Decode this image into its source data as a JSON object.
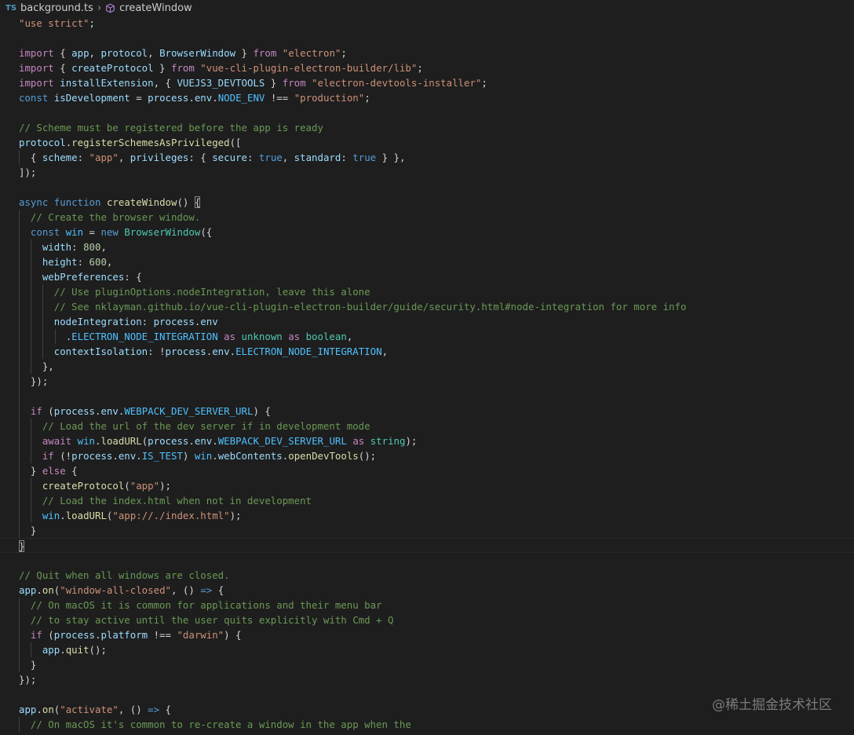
{
  "breadcrumb": {
    "lang_badge": "TS",
    "file": "background.ts",
    "symbol": "createWindow"
  },
  "colors": {
    "background": "#1e1e1e",
    "keyword": "#569cd6",
    "control": "#c586c0",
    "string": "#ce9178",
    "comment": "#6a9955",
    "function": "#dcdcaa",
    "variable": "#9cdcfe",
    "constant": "#4fc1ff",
    "number": "#b5cea8",
    "type": "#4ec9b0"
  },
  "editor": {
    "active_line": 35,
    "lines": [
      {
        "indent": 0,
        "tokens": [
          [
            "str",
            "\"use strict\""
          ],
          [
            "pun",
            ";"
          ]
        ]
      },
      {
        "indent": 0,
        "tokens": []
      },
      {
        "indent": 0,
        "tokens": [
          [
            "ctl",
            "import"
          ],
          [
            "pun",
            " { "
          ],
          [
            "var",
            "app"
          ],
          [
            "pun",
            ", "
          ],
          [
            "var",
            "protocol"
          ],
          [
            "pun",
            ", "
          ],
          [
            "var",
            "BrowserWindow"
          ],
          [
            "pun",
            " } "
          ],
          [
            "ctl",
            "from"
          ],
          [
            "pun",
            " "
          ],
          [
            "str",
            "\"electron\""
          ],
          [
            "pun",
            ";"
          ]
        ]
      },
      {
        "indent": 0,
        "tokens": [
          [
            "ctl",
            "import"
          ],
          [
            "pun",
            " { "
          ],
          [
            "var",
            "createProtocol"
          ],
          [
            "pun",
            " } "
          ],
          [
            "ctl",
            "from"
          ],
          [
            "pun",
            " "
          ],
          [
            "str",
            "\"vue-cli-plugin-electron-builder/lib\""
          ],
          [
            "pun",
            ";"
          ]
        ]
      },
      {
        "indent": 0,
        "tokens": [
          [
            "ctl",
            "import"
          ],
          [
            "pun",
            " "
          ],
          [
            "var",
            "installExtension"
          ],
          [
            "pun",
            ", { "
          ],
          [
            "var",
            "VUEJS3_DEVTOOLS"
          ],
          [
            "pun",
            " } "
          ],
          [
            "ctl",
            "from"
          ],
          [
            "pun",
            " "
          ],
          [
            "str",
            "\"electron-devtools-installer\""
          ],
          [
            "pun",
            ";"
          ]
        ]
      },
      {
        "indent": 0,
        "tokens": [
          [
            "kw",
            "const"
          ],
          [
            "pun",
            " "
          ],
          [
            "var",
            "isDevelopment"
          ],
          [
            "pun",
            " = "
          ],
          [
            "var",
            "process"
          ],
          [
            "pun",
            "."
          ],
          [
            "var",
            "env"
          ],
          [
            "pun",
            "."
          ],
          [
            "cst",
            "NODE_ENV"
          ],
          [
            "pun",
            " !== "
          ],
          [
            "str",
            "\"production\""
          ],
          [
            "pun",
            ";"
          ]
        ]
      },
      {
        "indent": 0,
        "tokens": []
      },
      {
        "indent": 0,
        "tokens": [
          [
            "com",
            "// Scheme must be registered before the app is ready"
          ]
        ]
      },
      {
        "indent": 0,
        "tokens": [
          [
            "var",
            "protocol"
          ],
          [
            "pun",
            "."
          ],
          [
            "fn",
            "registerSchemesAsPrivileged"
          ],
          [
            "pun",
            "(["
          ]
        ]
      },
      {
        "indent": 1,
        "tokens": [
          [
            "pun",
            "{ "
          ],
          [
            "var",
            "scheme"
          ],
          [
            "pun",
            ": "
          ],
          [
            "str",
            "\"app\""
          ],
          [
            "pun",
            ", "
          ],
          [
            "var",
            "privileges"
          ],
          [
            "pun",
            ": { "
          ],
          [
            "var",
            "secure"
          ],
          [
            "pun",
            ": "
          ],
          [
            "kw",
            "true"
          ],
          [
            "pun",
            ", "
          ],
          [
            "var",
            "standard"
          ],
          [
            "pun",
            ": "
          ],
          [
            "kw",
            "true"
          ],
          [
            "pun",
            " } },"
          ]
        ]
      },
      {
        "indent": 0,
        "tokens": [
          [
            "pun",
            "]);"
          ]
        ]
      },
      {
        "indent": 0,
        "tokens": []
      },
      {
        "indent": 0,
        "tokens": [
          [
            "kw",
            "async"
          ],
          [
            "pun",
            " "
          ],
          [
            "kw",
            "function"
          ],
          [
            "pun",
            " "
          ],
          [
            "fn",
            "createWindow"
          ],
          [
            "pun",
            "() "
          ],
          [
            "bm",
            "{"
          ]
        ]
      },
      {
        "indent": 1,
        "tokens": [
          [
            "com",
            "// Create the browser window."
          ]
        ]
      },
      {
        "indent": 1,
        "tokens": [
          [
            "kw",
            "const"
          ],
          [
            "pun",
            " "
          ],
          [
            "cst",
            "win"
          ],
          [
            "pun",
            " = "
          ],
          [
            "kw",
            "new"
          ],
          [
            "pun",
            " "
          ],
          [
            "typ",
            "BrowserWindow"
          ],
          [
            "pun",
            "({"
          ]
        ]
      },
      {
        "indent": 2,
        "tokens": [
          [
            "var",
            "width"
          ],
          [
            "pun",
            ": "
          ],
          [
            "num",
            "800"
          ],
          [
            "pun",
            ","
          ]
        ]
      },
      {
        "indent": 2,
        "tokens": [
          [
            "var",
            "height"
          ],
          [
            "pun",
            ": "
          ],
          [
            "num",
            "600"
          ],
          [
            "pun",
            ","
          ]
        ]
      },
      {
        "indent": 2,
        "tokens": [
          [
            "var",
            "webPreferences"
          ],
          [
            "pun",
            ": {"
          ]
        ]
      },
      {
        "indent": 3,
        "tokens": [
          [
            "com",
            "// Use pluginOptions.nodeIntegration, leave this alone"
          ]
        ]
      },
      {
        "indent": 3,
        "tokens": [
          [
            "com",
            "// See nklayman.github.io/vue-cli-plugin-electron-builder/guide/security.html#node-integration for more info"
          ]
        ]
      },
      {
        "indent": 3,
        "tokens": [
          [
            "var",
            "nodeIntegration"
          ],
          [
            "pun",
            ": "
          ],
          [
            "var",
            "process"
          ],
          [
            "pun",
            "."
          ],
          [
            "var",
            "env"
          ]
        ]
      },
      {
        "indent": 4,
        "tokens": [
          [
            "pun",
            "."
          ],
          [
            "cst",
            "ELECTRON_NODE_INTEGRATION"
          ],
          [
            "pun",
            " "
          ],
          [
            "ctl",
            "as"
          ],
          [
            "pun",
            " "
          ],
          [
            "typ",
            "unknown"
          ],
          [
            "pun",
            " "
          ],
          [
            "ctl",
            "as"
          ],
          [
            "pun",
            " "
          ],
          [
            "typ",
            "boolean"
          ],
          [
            "pun",
            ","
          ]
        ]
      },
      {
        "indent": 3,
        "tokens": [
          [
            "var",
            "contextIsolation"
          ],
          [
            "pun",
            ": !"
          ],
          [
            "var",
            "process"
          ],
          [
            "pun",
            "."
          ],
          [
            "var",
            "env"
          ],
          [
            "pun",
            "."
          ],
          [
            "cst",
            "ELECTRON_NODE_INTEGRATION"
          ],
          [
            "pun",
            ","
          ]
        ]
      },
      {
        "indent": 2,
        "tokens": [
          [
            "pun",
            "},"
          ]
        ]
      },
      {
        "indent": 1,
        "tokens": [
          [
            "pun",
            "});"
          ]
        ]
      },
      {
        "indent": 1,
        "tokens": []
      },
      {
        "indent": 1,
        "tokens": [
          [
            "ctl",
            "if"
          ],
          [
            "pun",
            " ("
          ],
          [
            "var",
            "process"
          ],
          [
            "pun",
            "."
          ],
          [
            "var",
            "env"
          ],
          [
            "pun",
            "."
          ],
          [
            "cst",
            "WEBPACK_DEV_SERVER_URL"
          ],
          [
            "pun",
            ") {"
          ]
        ]
      },
      {
        "indent": 2,
        "tokens": [
          [
            "com",
            "// Load the url of the dev server if in development mode"
          ]
        ]
      },
      {
        "indent": 2,
        "tokens": [
          [
            "ctl",
            "await"
          ],
          [
            "pun",
            " "
          ],
          [
            "cst",
            "win"
          ],
          [
            "pun",
            "."
          ],
          [
            "fn",
            "loadURL"
          ],
          [
            "pun",
            "("
          ],
          [
            "var",
            "process"
          ],
          [
            "pun",
            "."
          ],
          [
            "var",
            "env"
          ],
          [
            "pun",
            "."
          ],
          [
            "cst",
            "WEBPACK_DEV_SERVER_URL"
          ],
          [
            "pun",
            " "
          ],
          [
            "ctl",
            "as"
          ],
          [
            "pun",
            " "
          ],
          [
            "typ",
            "string"
          ],
          [
            "pun",
            ");"
          ]
        ]
      },
      {
        "indent": 2,
        "tokens": [
          [
            "ctl",
            "if"
          ],
          [
            "pun",
            " (!"
          ],
          [
            "var",
            "process"
          ],
          [
            "pun",
            "."
          ],
          [
            "var",
            "env"
          ],
          [
            "pun",
            "."
          ],
          [
            "cst",
            "IS_TEST"
          ],
          [
            "pun",
            ") "
          ],
          [
            "cst",
            "win"
          ],
          [
            "pun",
            "."
          ],
          [
            "var",
            "webContents"
          ],
          [
            "pun",
            "."
          ],
          [
            "fn",
            "openDevTools"
          ],
          [
            "pun",
            "();"
          ]
        ]
      },
      {
        "indent": 1,
        "tokens": [
          [
            "pun",
            "} "
          ],
          [
            "ctl",
            "else"
          ],
          [
            "pun",
            " {"
          ]
        ]
      },
      {
        "indent": 2,
        "tokens": [
          [
            "fn",
            "createProtocol"
          ],
          [
            "pun",
            "("
          ],
          [
            "str",
            "\"app\""
          ],
          [
            "pun",
            ");"
          ]
        ]
      },
      {
        "indent": 2,
        "tokens": [
          [
            "com",
            "// Load the index.html when not in development"
          ]
        ]
      },
      {
        "indent": 2,
        "tokens": [
          [
            "cst",
            "win"
          ],
          [
            "pun",
            "."
          ],
          [
            "fn",
            "loadURL"
          ],
          [
            "pun",
            "("
          ],
          [
            "str",
            "\"app://./index.html\""
          ],
          [
            "pun",
            ");"
          ]
        ]
      },
      {
        "indent": 1,
        "tokens": [
          [
            "pun",
            "}"
          ]
        ]
      },
      {
        "indent": 0,
        "tokens": [
          [
            "bm",
            "}"
          ]
        ]
      },
      {
        "indent": 0,
        "tokens": []
      },
      {
        "indent": 0,
        "tokens": [
          [
            "com",
            "// Quit when all windows are closed."
          ]
        ]
      },
      {
        "indent": 0,
        "tokens": [
          [
            "var",
            "app"
          ],
          [
            "pun",
            "."
          ],
          [
            "fn",
            "on"
          ],
          [
            "pun",
            "("
          ],
          [
            "str",
            "\"window-all-closed\""
          ],
          [
            "pun",
            ", () "
          ],
          [
            "kw",
            "=>"
          ],
          [
            "pun",
            " {"
          ]
        ]
      },
      {
        "indent": 1,
        "tokens": [
          [
            "com",
            "// On macOS it is common for applications and their menu bar"
          ]
        ]
      },
      {
        "indent": 1,
        "tokens": [
          [
            "com",
            "// to stay active until the user quits explicitly with Cmd + Q"
          ]
        ]
      },
      {
        "indent": 1,
        "tokens": [
          [
            "ctl",
            "if"
          ],
          [
            "pun",
            " ("
          ],
          [
            "var",
            "process"
          ],
          [
            "pun",
            "."
          ],
          [
            "var",
            "platform"
          ],
          [
            "pun",
            " !== "
          ],
          [
            "str",
            "\"darwin\""
          ],
          [
            "pun",
            ") {"
          ]
        ]
      },
      {
        "indent": 2,
        "tokens": [
          [
            "var",
            "app"
          ],
          [
            "pun",
            "."
          ],
          [
            "fn",
            "quit"
          ],
          [
            "pun",
            "();"
          ]
        ]
      },
      {
        "indent": 1,
        "tokens": [
          [
            "pun",
            "}"
          ]
        ]
      },
      {
        "indent": 0,
        "tokens": [
          [
            "pun",
            "});"
          ]
        ]
      },
      {
        "indent": 0,
        "tokens": []
      },
      {
        "indent": 0,
        "tokens": [
          [
            "var",
            "app"
          ],
          [
            "pun",
            "."
          ],
          [
            "fn",
            "on"
          ],
          [
            "pun",
            "("
          ],
          [
            "str",
            "\"activate\""
          ],
          [
            "pun",
            ", () "
          ],
          [
            "kw",
            "=>"
          ],
          [
            "pun",
            " {"
          ]
        ]
      },
      {
        "indent": 1,
        "tokens": [
          [
            "com",
            "// On macOS it's common to re-create a window in the app when the"
          ]
        ]
      }
    ]
  },
  "watermark": "@稀土掘金技术社区"
}
